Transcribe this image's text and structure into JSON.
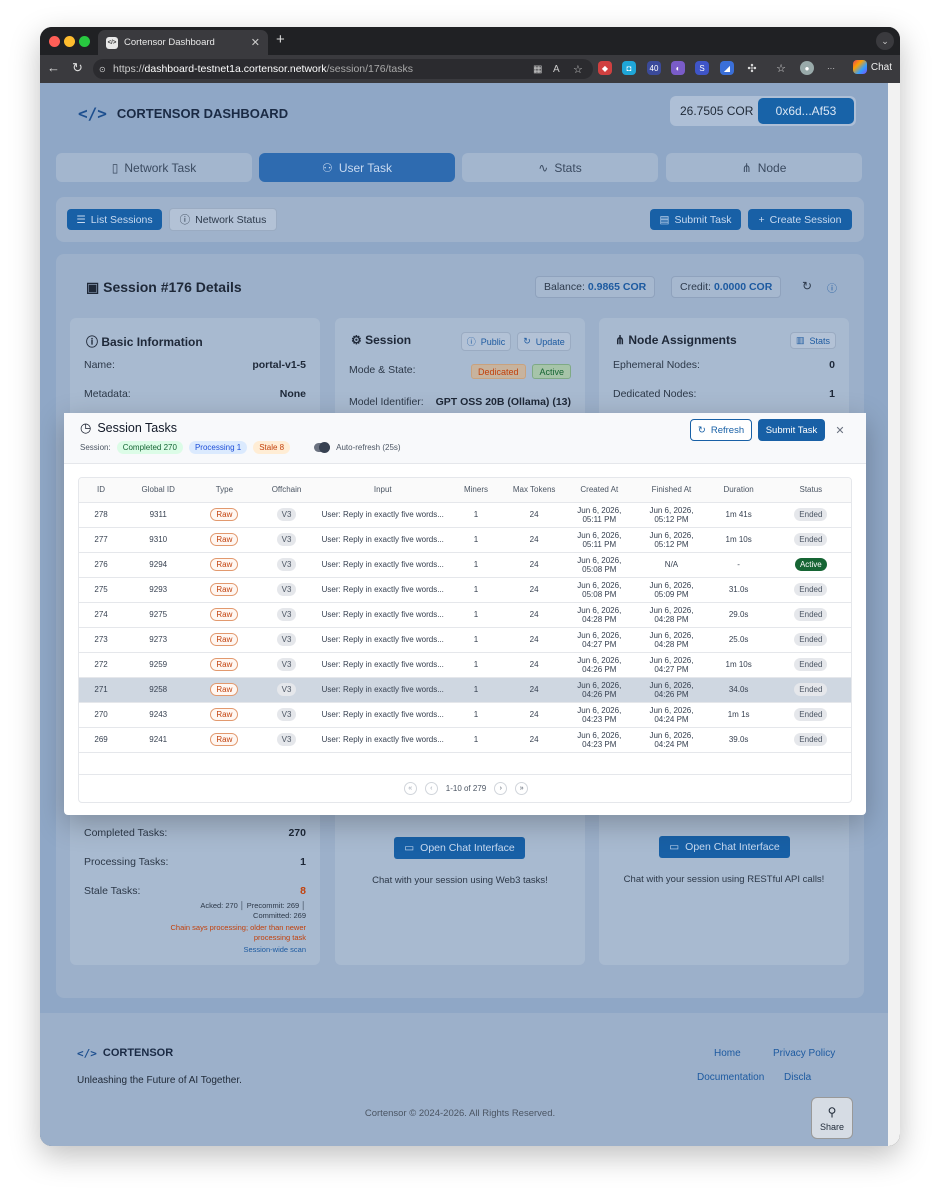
{
  "browser": {
    "tab_title": "Cortensor Dashboard",
    "url_prefix": "https://",
    "url_host": "dashboard-testnet1a.cortensor.network",
    "url_path": "/session/176/tasks",
    "chat_label": "Chat",
    "ext_badge": "40"
  },
  "header": {
    "logo_mark": "</>",
    "title": "CORTENSOR DASHBOARD",
    "balance": "26.7505 COR",
    "wallet": "0x6d...Af53"
  },
  "nav": {
    "tabs": [
      "Network Task",
      "User Task",
      "Stats",
      "Node"
    ]
  },
  "toolbar": {
    "list_sessions": "List Sessions",
    "network_status": "Network Status",
    "submit_task": "Submit Task",
    "create_session": "Create Session"
  },
  "session": {
    "title": "Session #176 Details",
    "balance_label": "Balance:",
    "balance_value": "0.9865 COR",
    "credit_label": "Credit:",
    "credit_value": "0.0000 COR"
  },
  "basic_info": {
    "title": "Basic Information",
    "name_label": "Name:",
    "name_value": "portal-v1-5",
    "metadata_label": "Metadata:",
    "metadata_value": "None",
    "completed_label": "Completed Tasks:",
    "completed_value": "270",
    "processing_label": "Processing Tasks:",
    "processing_value": "1",
    "stale_label": "Stale Tasks:",
    "stale_value": "8",
    "acked_line": "Acked: 270 │ Precommit: 269 │",
    "committed_line": "Committed: 269",
    "chain_note_1": "Chain says processing; older than newer",
    "chain_note_2": "processing task",
    "scan_note": "Session-wide scan"
  },
  "session_card": {
    "title": "Session",
    "public_btn": "Public",
    "update_btn": "Update",
    "mode_label": "Mode & State:",
    "mode_tag": "Dedicated",
    "state_tag": "Active",
    "model_label": "Model Identifier:",
    "model_value": "GPT OSS 20B (Ollama) (13)",
    "chat_btn": "Open Chat Interface",
    "chat_note": "Chat with your session using Web3 tasks!"
  },
  "nodes_card": {
    "title": "Node Assignments",
    "stats_btn": "Stats",
    "ephemeral_label": "Ephemeral Nodes:",
    "ephemeral_value": "0",
    "dedicated_label": "Dedicated Nodes:",
    "dedicated_value": "1",
    "chat_btn": "Open Chat Interface",
    "chat_note": "Chat with your session using RESTful API calls!"
  },
  "modal": {
    "title": "Session Tasks",
    "session_label": "Session:",
    "completed_chip": "Completed 270",
    "processing_chip": "Processing 1",
    "stale_chip": "Stale 8",
    "autorefresh": "Auto-refresh (25s)",
    "refresh_btn": "Refresh",
    "submit_btn": "Submit Task",
    "columns": [
      "ID",
      "Global ID",
      "Type",
      "Offchain",
      "Input",
      "Miners",
      "Max Tokens",
      "Created At",
      "Finished At",
      "Duration",
      "Status"
    ],
    "rows": [
      {
        "id": "278",
        "gid": "9311",
        "type": "Raw",
        "off": "V3",
        "input": "User: Reply in exactly five words...",
        "miners": "1",
        "tokens": "24",
        "c1": "Jun 6, 2026,",
        "c2": "05:11 PM",
        "f1": "Jun 6, 2026,",
        "f2": "05:12 PM",
        "dur": "1m 41s",
        "status": "Ended"
      },
      {
        "id": "277",
        "gid": "9310",
        "type": "Raw",
        "off": "V3",
        "input": "User: Reply in exactly five words...",
        "miners": "1",
        "tokens": "24",
        "c1": "Jun 6, 2026,",
        "c2": "05:11 PM",
        "f1": "Jun 6, 2026,",
        "f2": "05:12 PM",
        "dur": "1m 10s",
        "status": "Ended"
      },
      {
        "id": "276",
        "gid": "9294",
        "type": "Raw",
        "off": "V3",
        "input": "User: Reply in exactly five words...",
        "miners": "1",
        "tokens": "24",
        "c1": "Jun 6, 2026,",
        "c2": "05:08 PM",
        "f1": "N/A",
        "f2": "",
        "dur": "-",
        "status": "Active"
      },
      {
        "id": "275",
        "gid": "9293",
        "type": "Raw",
        "off": "V3",
        "input": "User: Reply in exactly five words...",
        "miners": "1",
        "tokens": "24",
        "c1": "Jun 6, 2026,",
        "c2": "05:08 PM",
        "f1": "Jun 6, 2026,",
        "f2": "05:09 PM",
        "dur": "31.0s",
        "status": "Ended"
      },
      {
        "id": "274",
        "gid": "9275",
        "type": "Raw",
        "off": "V3",
        "input": "User: Reply in exactly five words...",
        "miners": "1",
        "tokens": "24",
        "c1": "Jun 6, 2026,",
        "c2": "04:28 PM",
        "f1": "Jun 6, 2026,",
        "f2": "04:28 PM",
        "dur": "29.0s",
        "status": "Ended"
      },
      {
        "id": "273",
        "gid": "9273",
        "type": "Raw",
        "off": "V3",
        "input": "User: Reply in exactly five words...",
        "miners": "1",
        "tokens": "24",
        "c1": "Jun 6, 2026,",
        "c2": "04:27 PM",
        "f1": "Jun 6, 2026,",
        "f2": "04:28 PM",
        "dur": "25.0s",
        "status": "Ended"
      },
      {
        "id": "272",
        "gid": "9259",
        "type": "Raw",
        "off": "V3",
        "input": "User: Reply in exactly five words...",
        "miners": "1",
        "tokens": "24",
        "c1": "Jun 6, 2026,",
        "c2": "04:26 PM",
        "f1": "Jun 6, 2026,",
        "f2": "04:27 PM",
        "dur": "1m 10s",
        "status": "Ended"
      },
      {
        "id": "271",
        "gid": "9258",
        "type": "Raw",
        "off": "V3",
        "input": "User: Reply in exactly five words...",
        "miners": "1",
        "tokens": "24",
        "c1": "Jun 6, 2026,",
        "c2": "04:26 PM",
        "f1": "Jun 6, 2026,",
        "f2": "04:26 PM",
        "dur": "34.0s",
        "status": "Ended"
      },
      {
        "id": "270",
        "gid": "9243",
        "type": "Raw",
        "off": "V3",
        "input": "User: Reply in exactly five words...",
        "miners": "1",
        "tokens": "24",
        "c1": "Jun 6, 2026,",
        "c2": "04:23 PM",
        "f1": "Jun 6, 2026,",
        "f2": "04:24 PM",
        "dur": "1m 1s",
        "status": "Ended"
      },
      {
        "id": "269",
        "gid": "9241",
        "type": "Raw",
        "off": "V3",
        "input": "User: Reply in exactly five words...",
        "miners": "1",
        "tokens": "24",
        "c1": "Jun 6, 2026,",
        "c2": "04:23 PM",
        "f1": "Jun 6, 2026,",
        "f2": "04:24 PM",
        "dur": "39.0s",
        "status": "Ended"
      }
    ],
    "pagination": "1-10 of 279"
  },
  "footer": {
    "logo": "CORTENSOR",
    "tagline": "Unleashing the Future of AI Together.",
    "home": "Home",
    "privacy": "Privacy Policy",
    "docs": "Documentation",
    "discl": "Discla",
    "copyright": "Cortensor © 2024-2026. All Rights Reserved.",
    "share": "Share"
  },
  "colors": {
    "brand": "#1860a6",
    "stale": "#c2410c",
    "active": "#166534"
  }
}
